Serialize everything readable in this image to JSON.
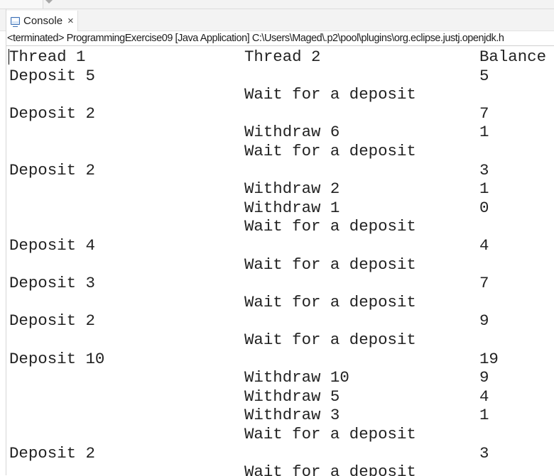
{
  "tab": {
    "icon": "console-icon",
    "label": "Console",
    "close": "×"
  },
  "status_line": "<terminated> ProgrammingExercise09 [Java Application] C:\\Users\\Maged\\.p2\\pool\\plugins\\org.eclipse.justj.openjdk.h",
  "console": {
    "headers": [
      "Thread 1",
      "Thread 2",
      "Balance"
    ],
    "rows": [
      [
        "Deposit 5",
        "",
        "5"
      ],
      [
        "",
        "Wait for a deposit",
        ""
      ],
      [
        "Deposit 2",
        "",
        "7"
      ],
      [
        "",
        "Withdraw 6",
        "1"
      ],
      [
        "",
        "Wait for a deposit",
        ""
      ],
      [
        "Deposit 2",
        "",
        "3"
      ],
      [
        "",
        "Withdraw 2",
        "1"
      ],
      [
        "",
        "Withdraw 1",
        "0"
      ],
      [
        "",
        "Wait for a deposit",
        ""
      ],
      [
        "Deposit 4",
        "",
        "4"
      ],
      [
        "",
        "Wait for a deposit",
        ""
      ],
      [
        "Deposit 3",
        "",
        "7"
      ],
      [
        "",
        "Wait for a deposit",
        ""
      ],
      [
        "Deposit 2",
        "",
        "9"
      ],
      [
        "",
        "Wait for a deposit",
        ""
      ],
      [
        "Deposit 10",
        "",
        "19"
      ],
      [
        "",
        "Withdraw 10",
        "9"
      ],
      [
        "",
        "Withdraw 5",
        "4"
      ],
      [
        "",
        "Withdraw 3",
        "1"
      ],
      [
        "",
        "Wait for a deposit",
        ""
      ],
      [
        "Deposit 2",
        "",
        "3"
      ],
      [
        "",
        "Wait for a deposit",
        ""
      ]
    ]
  }
}
